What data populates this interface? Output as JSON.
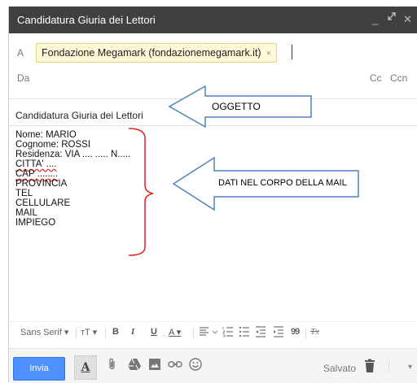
{
  "window": {
    "title": "Candidatura Giuria dei Lettori",
    "minimize": "_",
    "close": "✕"
  },
  "recipients": {
    "to_label": "A",
    "chip": "Fondazione Megamark (fondazionemegamark.it)",
    "chip_remove": "×",
    "from_label": "Da",
    "cc_label": "Cc",
    "bcc_label": "Ccn"
  },
  "subject": {
    "value": "Candidatura Giuria dei Lettori"
  },
  "body": {
    "lines": [
      "Nome: MARIO",
      "Cognome: ROSSI",
      "Residenza: VIA .... ..... N.....",
      "CITTA' ....",
      "CAP ........",
      "PROVINCIA",
      "TEL",
      "CELLULARE",
      "MAIL",
      "IMPIEGO"
    ]
  },
  "annotations": {
    "subject_arrow_label": "OGGETTO",
    "body_arrow_label": "DATI NEL CORPO DELLA MAIL"
  },
  "toolbar": {
    "font": "Sans Serif",
    "dropdown": "▾",
    "size": "тT",
    "bold": "B",
    "italic": "I",
    "underline": "U",
    "text_color": "A",
    "quote": "99",
    "clear": "Tx"
  },
  "bottom": {
    "send_label": "Invia",
    "format_label": "A",
    "saved_label": "Salvato"
  },
  "colors": {
    "send": "#4d90fe",
    "titlebar": "#404040",
    "chip_bg": "#fff8d6",
    "brace": "#e0201b"
  }
}
